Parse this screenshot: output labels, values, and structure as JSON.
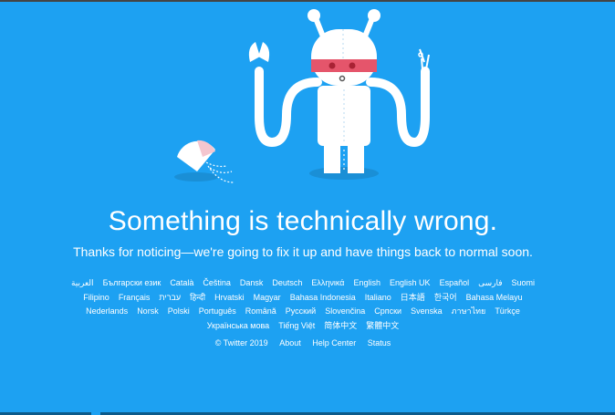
{
  "page": {
    "headline": "Something is technically wrong.",
    "subline": "Thanks for noticing—we're going to fix it up and have things back to normal soon."
  },
  "illustration": {
    "name": "broken-robot-illustration",
    "background": "#1da1f2",
    "accent_band": "#e5556b",
    "body_color": "#ffffff",
    "shadow_color": "#1a8fd6"
  },
  "languages": [
    "العربية",
    "Български език",
    "Català",
    "Čeština",
    "Dansk",
    "Deutsch",
    "Ελληνικά",
    "English",
    "English UK",
    "Español",
    "فارسی",
    "Suomi",
    "Filipino",
    "Français",
    "עברית",
    "हिन्दी",
    "Hrvatski",
    "Magyar",
    "Bahasa Indonesia",
    "Italiano",
    "日本語",
    "한국어",
    "Bahasa Melayu",
    "Nederlands",
    "Norsk",
    "Polski",
    "Português",
    "Română",
    "Русский",
    "Slovenčina",
    "Српски",
    "Svenska",
    "ภาษาไทย",
    "Türkçe",
    "Українська мова",
    "Tiếng Việt",
    "简体中文",
    "繁體中文"
  ],
  "footer": {
    "copyright": "© Twitter 2019",
    "about": "About",
    "help_center": "Help Center",
    "status": "Status"
  }
}
